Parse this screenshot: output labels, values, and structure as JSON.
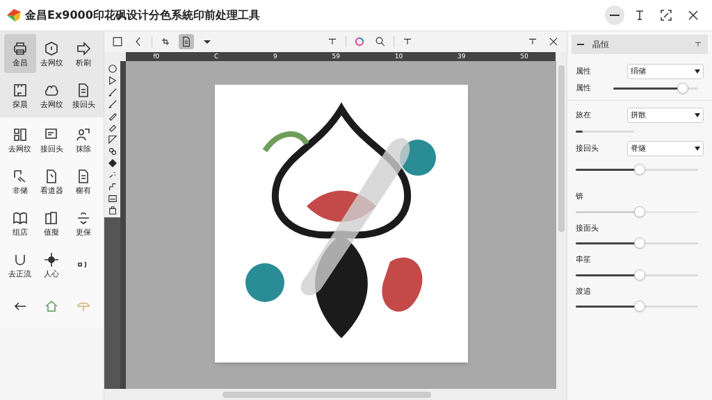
{
  "window": {
    "title": "金昌Ex9000印花砜设计分色系統印前处理工具"
  },
  "tool_groups": [
    {
      "shaded": true,
      "tools": [
        {
          "label": "金昌",
          "selected": true
        },
        {
          "label": "去网纹",
          "selected": false
        },
        {
          "label": "析刷",
          "selected": false
        },
        {
          "label": "探晨",
          "selected": false
        },
        {
          "label": "去网纹",
          "selected": false
        },
        {
          "label": "接回头",
          "selected": false
        }
      ]
    },
    {
      "shaded": false,
      "tools": [
        {
          "label": "去网纹",
          "selected": false
        },
        {
          "label": "接回头",
          "selected": false
        },
        {
          "label": "抹除",
          "selected": false
        },
        {
          "label": "非储",
          "selected": false
        },
        {
          "label": "看道器",
          "selected": false
        },
        {
          "label": "榭有",
          "selected": false
        },
        {
          "label": "组店",
          "selected": false
        },
        {
          "label": "值擬",
          "selected": false
        },
        {
          "label": "更保",
          "selected": false
        },
        {
          "label": "去正流",
          "selected": false
        },
        {
          "label": "人心",
          "selected": false
        },
        {
          "selected": false
        },
        {
          "selected": false
        },
        {
          "selected": false
        },
        {
          "selected": false
        }
      ]
    }
  ],
  "toolbar": [
    {
      "selected": false
    },
    {
      "selected": false
    },
    {
      "selected": false
    },
    {
      "selected": true
    },
    {
      "selected": false
    },
    {
      "selected": false
    },
    {
      "selected": false
    },
    {
      "selected": false
    },
    {
      "selected": false
    },
    {
      "selected": false
    },
    {
      "selected": false
    }
  ],
  "ruler_labels": [
    "f0",
    "C",
    "9",
    "59",
    "10",
    "39",
    "50"
  ],
  "panel": {
    "title": "晶恒",
    "rows": [
      {
        "kind": "select",
        "label": "属性",
        "value": "绢储"
      },
      {
        "kind": "slider",
        "label": "属性",
        "level": 0.82,
        "disabled": false
      },
      {
        "kind": "divider"
      },
      {
        "kind": "select",
        "label": "旅在",
        "value": "拼散"
      },
      {
        "kind": "short_slider",
        "level": 0.12,
        "disabled": false
      },
      {
        "kind": "select",
        "label": "接回头",
        "value": "脊燧"
      },
      {
        "kind": "slider",
        "level": 0.52,
        "disabled": false
      },
      {
        "kind": "slider",
        "label": "锛",
        "level": 0.52,
        "disabled": true
      },
      {
        "kind": "slider",
        "label": "接面头",
        "level": 0.52,
        "disabled": false
      },
      {
        "kind": "slider",
        "label": "串笙",
        "level": 0.52,
        "disabled": false
      },
      {
        "kind": "slider",
        "label": "渡追",
        "level": 0.52,
        "disabled": false
      }
    ]
  }
}
